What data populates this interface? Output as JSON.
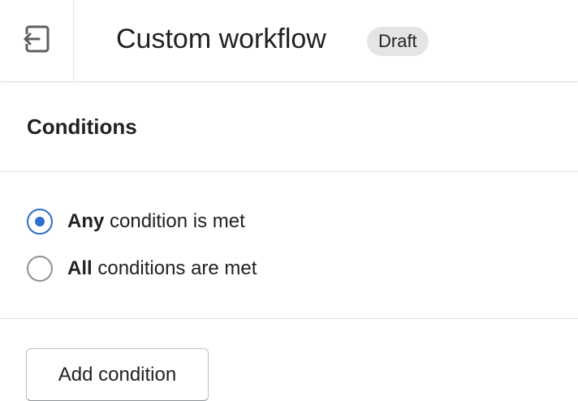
{
  "header": {
    "exit_icon": "exit-arrow-icon",
    "title": "Custom workflow",
    "status_badge": "Draft"
  },
  "conditions": {
    "section_title": "Conditions",
    "options": [
      {
        "bold": "Any",
        "rest": " condition is met",
        "selected": true
      },
      {
        "bold": "All",
        "rest": " conditions are met",
        "selected": false
      }
    ],
    "add_button_label": "Add condition"
  },
  "colors": {
    "accent": "#2c6ecb",
    "badge_bg": "#e4e5e7",
    "divider": "#e1e3e5",
    "text": "#202223"
  }
}
